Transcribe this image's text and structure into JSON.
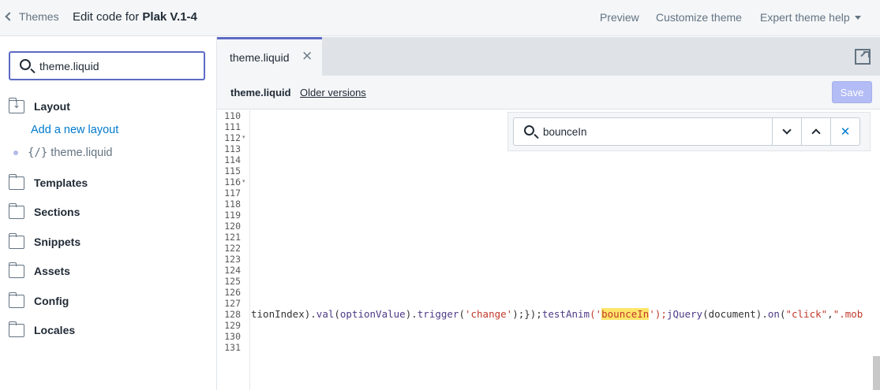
{
  "header": {
    "back_label": "Themes",
    "title_prefix": "Edit code for",
    "theme_name": "Plak V.1-4",
    "preview": "Preview",
    "customize": "Customize theme",
    "help": "Expert theme help"
  },
  "sidebar": {
    "search_value": "theme.liquid",
    "folders": {
      "layout": "Layout",
      "templates": "Templates",
      "sections": "Sections",
      "snippets": "Snippets",
      "assets": "Assets",
      "config": "Config",
      "locales": "Locales"
    },
    "add_layout": "Add a new layout",
    "file_icon": "{/}",
    "file_name": "theme.liquid"
  },
  "editor": {
    "tab_label": "theme.liquid",
    "file_name": "theme.liquid",
    "older_versions": "Older versions",
    "save_label": "Save",
    "find_value": "bounceIn",
    "line_numbers": [
      "110",
      "111",
      "112",
      "113",
      "114",
      "115",
      "116",
      "117",
      "118",
      "119",
      "120",
      "121",
      "122",
      "123",
      "124",
      "125",
      "126",
      "127",
      "128",
      "129",
      "130",
      "131"
    ],
    "code": {
      "p1": "tionIndex).",
      "p2": "val",
      "p3": "(",
      "p4": "optionValue",
      "p5": ").",
      "p6": "trigger",
      "p7": "(",
      "p8": "'change'",
      "p9": ");});",
      "p10": "testAnim",
      "p11": "('",
      "p12": "bounceIn",
      "p13": "');",
      "p14": "jQuery",
      "p15": "(document).",
      "p16": "on",
      "p17": "(",
      "p18": "\"click\"",
      "p19": ",",
      "p20": "\".mob"
    }
  },
  "icons": {
    "close": "×",
    "find_close": "✕",
    "fold_marker": "▾"
  },
  "colors": {
    "accent": "#5c6ac4",
    "link": "#007ace",
    "highlight": "#ffe56a",
    "string": "#c03a2b",
    "function": "#4d3a85"
  }
}
